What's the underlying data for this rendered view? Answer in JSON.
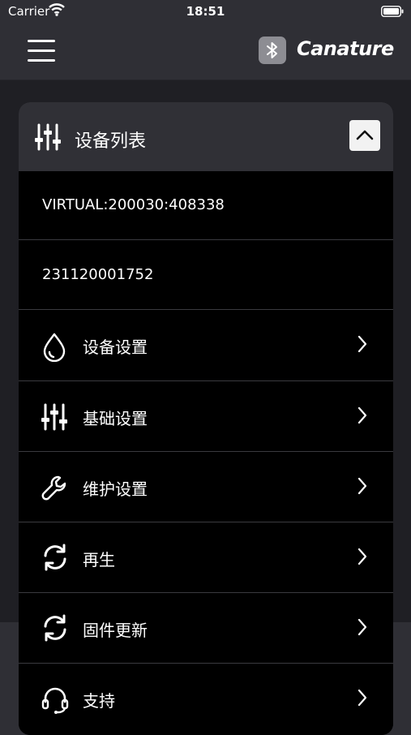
{
  "status_bar": {
    "carrier": "Carrier",
    "time": "18:51"
  },
  "header": {
    "brand": "Canature",
    "icons": [
      "menu-icon",
      "bluetooth-icon"
    ]
  },
  "card": {
    "title": "设备列表",
    "title_icon": "sliders-icon",
    "collapse_icon": "chevron-up-icon",
    "devices": [
      "VIRTUAL:200030:408338",
      "231120001752"
    ],
    "menu_items": [
      {
        "label": "设备设置",
        "icon": "water-drop-icon"
      },
      {
        "label": "基础设置",
        "icon": "sliders-icon"
      },
      {
        "label": "维护设置",
        "icon": "wrench-icon"
      },
      {
        "label": "再生",
        "icon": "refresh-icon"
      },
      {
        "label": "固件更新",
        "icon": "refresh-icon"
      },
      {
        "label": "支持",
        "icon": "headset-icon"
      }
    ]
  },
  "colors": {
    "background": "#2f2f35",
    "content": "#1f1f24",
    "card": "#000000",
    "card_header": "#303036"
  }
}
